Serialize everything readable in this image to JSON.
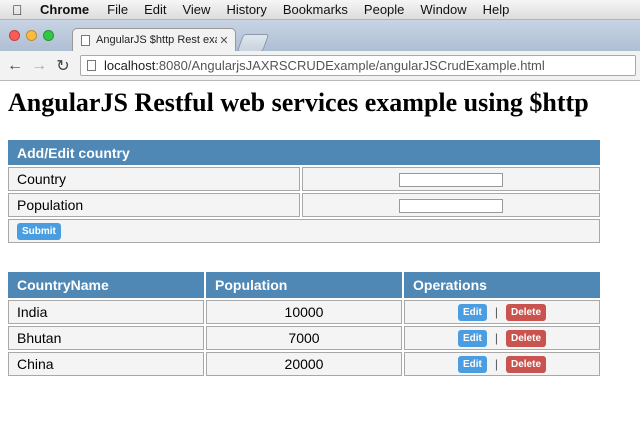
{
  "menubar": {
    "app": "Chrome",
    "items": [
      "File",
      "Edit",
      "View",
      "History",
      "Bookmarks",
      "People",
      "Window",
      "Help"
    ]
  },
  "tab": {
    "title": "AngularJS $http Rest exam"
  },
  "address": {
    "host": "localhost",
    "path": ":8080/AngularjsJAXRSCRUDExample/angularJSCrudExample.html"
  },
  "page": {
    "heading": "AngularJS Restful web services example using $http"
  },
  "form": {
    "title": "Add/Edit country",
    "country_label": "Country",
    "country_value": "",
    "population_label": "Population",
    "population_value": "",
    "submit_label": "Submit"
  },
  "grid": {
    "headers": [
      "CountryName",
      "Population",
      "Operations"
    ],
    "rows": [
      {
        "name": "India",
        "population": "10000"
      },
      {
        "name": "Bhutan",
        "population": "7000"
      },
      {
        "name": "China",
        "population": "20000"
      }
    ],
    "edit_label": "Edit",
    "delete_label": "Delete",
    "separator": "|"
  }
}
